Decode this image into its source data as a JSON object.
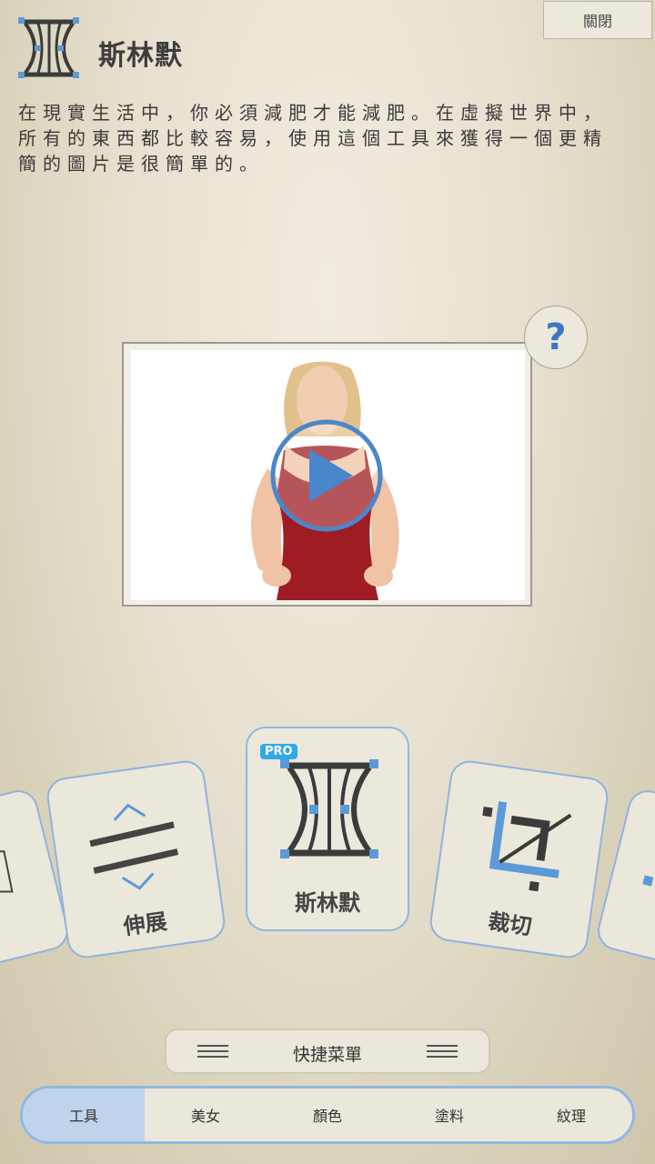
{
  "header": {
    "close_label": "關閉",
    "title": "斯林默",
    "description": "在現實生活中，你必須減肥才能減肥。在虛擬世界中，所有的東西都比較容易，使用這個工具來獲得一個更精簡的圖片是很簡單的。"
  },
  "video": {
    "help_label": "?",
    "play_icon": "play-icon"
  },
  "tools": {
    "cards": [
      {
        "label": "伸展",
        "icon": "stretch-icon"
      },
      {
        "label": "斯林默",
        "icon": "slimmer-icon",
        "badge": "PRO",
        "selected": true
      },
      {
        "label": "裁切",
        "icon": "crop-icon"
      }
    ]
  },
  "quick_menu": {
    "label": "快捷菜單"
  },
  "tabs": [
    {
      "label": "工具",
      "active": true
    },
    {
      "label": "美女"
    },
    {
      "label": "顏色"
    },
    {
      "label": "塗料"
    },
    {
      "label": "紋理"
    }
  ],
  "colors": {
    "accent": "#4a86cc",
    "card_border": "#8fb3dd",
    "pro_badge": "#33a8e8"
  }
}
